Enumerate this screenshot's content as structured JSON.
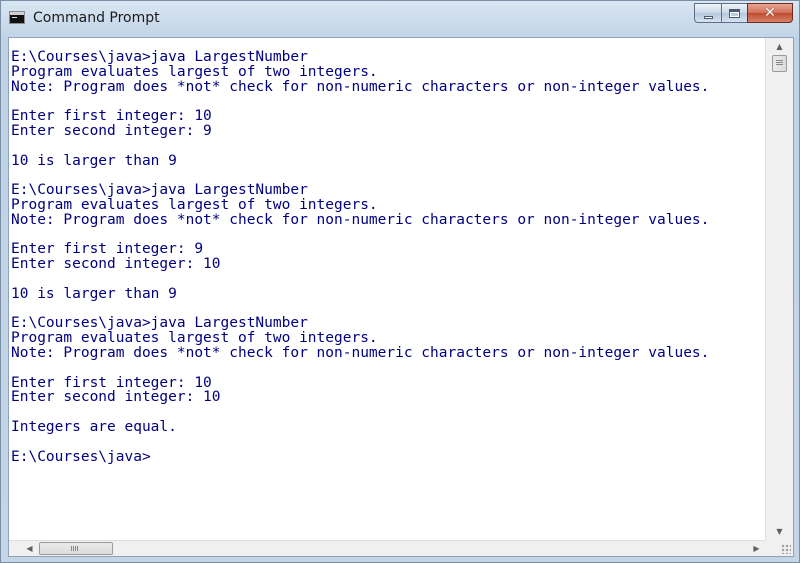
{
  "window": {
    "title": "Command Prompt",
    "icon": "cmd-icon",
    "controls": {
      "minimize_icon": "minimize-icon",
      "maximize_icon": "maximize-icon",
      "close_glyph": "✕"
    }
  },
  "console": {
    "text_color": "#000080",
    "background": "#ffffff",
    "output": "E:\\Courses\\java>java LargestNumber\nProgram evaluates largest of two integers.\nNote: Program does *not* check for non-numeric characters or non-integer values.\n\nEnter first integer: 10\nEnter second integer: 9\n\n10 is larger than 9\n\nE:\\Courses\\java>java LargestNumber\nProgram evaluates largest of two integers.\nNote: Program does *not* check for non-numeric characters or non-integer values.\n\nEnter first integer: 9\nEnter second integer: 10\n\n10 is larger than 9\n\nE:\\Courses\\java>java LargestNumber\nProgram evaluates largest of two integers.\nNote: Program does *not* check for non-numeric characters or non-integer values.\n\nEnter first integer: 10\nEnter second integer: 10\n\nIntegers are equal.\n\nE:\\Courses\\java>"
  },
  "scrollbars": {
    "up_arrow": "▲",
    "down_arrow": "▼",
    "left_arrow": "◀",
    "right_arrow": "▶"
  }
}
